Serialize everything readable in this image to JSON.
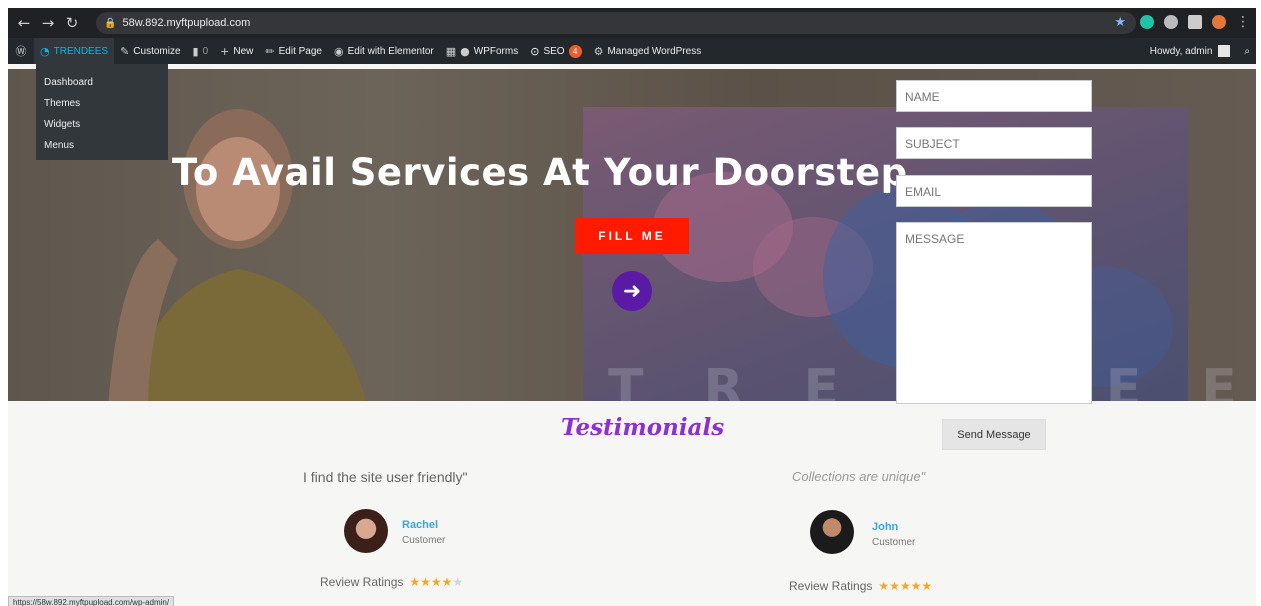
{
  "browser": {
    "url": "58w.892.myftpupload.com",
    "status_url": "https://58w.892.myftpupload.com/wp-admin/"
  },
  "adminbar": {
    "site": "TRENDEES",
    "customize": "Customize",
    "comments": "0",
    "new": "New",
    "edit_page": "Edit Page",
    "edit_elementor": "Edit with Elementor",
    "wpforms": "WPForms",
    "seo": "SEO",
    "seo_count": "4",
    "managed": "Managed WordPress",
    "howdy": "Howdy, admin"
  },
  "dropdown": {
    "items": [
      "Dashboard",
      "Themes",
      "Widgets",
      "Menus"
    ]
  },
  "hero": {
    "title": "To Avail Services At Your Doorstep",
    "cta": "FILL ME",
    "watermark": "TRENDEES"
  },
  "form": {
    "name_placeholder": "NAME",
    "subject_placeholder": "SUBJECT",
    "email_placeholder": "EMAIL",
    "message_placeholder": "MESSAGE",
    "send_label": "Send Message"
  },
  "testimonials": {
    "title": "Testimonials",
    "items": [
      {
        "quote": "I find the site user friendly\"",
        "name": "Rachel",
        "role": "Customer",
        "rating_label": "Review Ratings",
        "stars": 4
      },
      {
        "quote": "Collections are unique\"",
        "name": "John",
        "role": "Customer",
        "rating_label": "Review Ratings",
        "stars": 5
      }
    ]
  },
  "colors": {
    "cta_red": "#ff1a00",
    "arrow_purple": "#5b1aa5",
    "testimonial_title": "#8e2fd6",
    "wp_accent": "#00b9eb"
  }
}
